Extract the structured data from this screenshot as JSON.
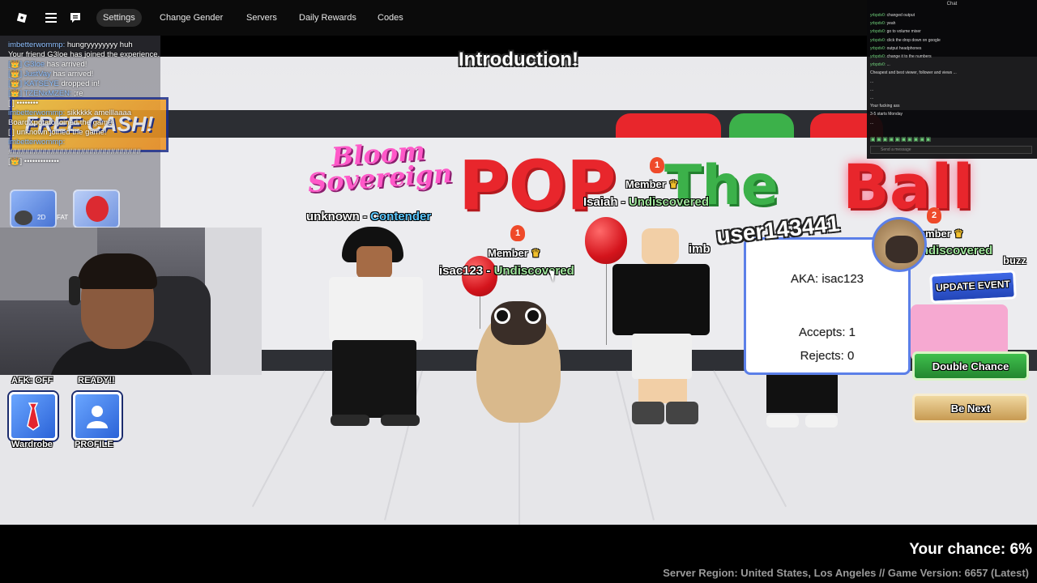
{
  "topbar": {
    "settings": "Settings",
    "change_gender": "Change Gender",
    "servers": "Servers",
    "daily_rewards": "Daily Rewards",
    "codes": "Codes"
  },
  "chat_log": [
    {
      "name": "imbetterwommp:",
      "text": " hungryyyyyyyy  huh"
    },
    {
      "name": "",
      "text": "Your friend G3loe has joined the experience."
    },
    {
      "name": "[👑] G3loe",
      "text": " has arrived!"
    },
    {
      "name": "[👑] JustVay",
      "text": " has arrived!"
    },
    {
      "name": "[👑] KATSEYE",
      "text": " dropped in!"
    },
    {
      "name": "[👑] TZENxMZEN:",
      "text": " ;re"
    },
    {
      "name": "",
      "text": "[ ] ••••••••"
    },
    {
      "name": "imbetterwommp:",
      "text": " sikkkkk amelllaaaa"
    },
    {
      "name": "",
      "text": "BoardXpotato joined the game!"
    },
    {
      "name": "",
      "text": "[ ] unknown joined the game!"
    },
    {
      "name": "imbetterwommp:",
      "text": ""
    },
    {
      "name": "",
      "text": "###############################"
    },
    {
      "name": "",
      "text": "[👑] •••••••••••••"
    }
  ],
  "free_cash": "FREE CASH!",
  "left_hud": {
    "afk": "AFK: OFF",
    "ready": "READY!!",
    "wardrobe": "Wardrobe",
    "profile": "PROFILE",
    "badge_2d": "2D",
    "badge_fat": "FAT"
  },
  "intro_title": "Introduction!",
  "sign": {
    "bloom": "Bloom Sovereign",
    "pop": "POP",
    "the": "The",
    "ball": "Ball"
  },
  "nametags": {
    "unknown_name": "unknown - ",
    "unknown_title": "Contender",
    "isac_rank": "Member",
    "isac_name": "isac123 - ",
    "isac_title": "Undiscovered",
    "isaiah_rank": "Member",
    "isaiah_name": "Isaiah - ",
    "isaiah_title": "Undiscovered",
    "right_rank": "Member",
    "right_title": "Undiscovered",
    "partial_left": "imb",
    "partial_right": "buzz",
    "badge_1": "1",
    "badge_2": "2"
  },
  "card": {
    "username": "user143441",
    "aka": "AKA: isac123",
    "accepts": "Accepts: 1",
    "rejects": "Rejects: 0"
  },
  "buttons": {
    "update_event": "UPDATE EVENT",
    "double_chance": "Double Chance",
    "be_next": "Be Next"
  },
  "footer": {
    "chance": "Your chance: 6%",
    "server": "Server Region: United States, Los Angeles // Game Version: 6657 (Latest)"
  },
  "right_chat": {
    "title": "Chat",
    "lines": [
      {
        "name": "yrbpdv0:",
        "text": " changed output"
      },
      {
        "name": "yrbpdv0:",
        "text": " yeah"
      },
      {
        "name": "yrbpdv0:",
        "text": " go to volume mixer"
      },
      {
        "name": "yrbpdv0:",
        "text": " click the drop down on google"
      },
      {
        "name": "yrbpdv0:",
        "text": " output headphones"
      },
      {
        "name": "yrbpdv0:",
        "text": " change it to the numbers"
      },
      {
        "name": "yrbpdv0:",
        "text": " ..."
      },
      {
        "name": "",
        "text": "Cheapest and best viewer, follower and views ..."
      },
      {
        "name": "",
        "text": "..."
      },
      {
        "name": "",
        "text": "..."
      },
      {
        "name": "",
        "text": "..."
      },
      {
        "name": "",
        "text": "Your fucking ass"
      },
      {
        "name": "",
        "text": "3-5 starts Monday"
      },
      {
        "name": "",
        "text": "..."
      }
    ],
    "placeholder": "Send a message"
  },
  "colors": {
    "pop_red": "#e8262c",
    "the_green": "#3cb14a",
    "card_border": "#5b7fe8",
    "double_green": "#3fbf4d"
  }
}
